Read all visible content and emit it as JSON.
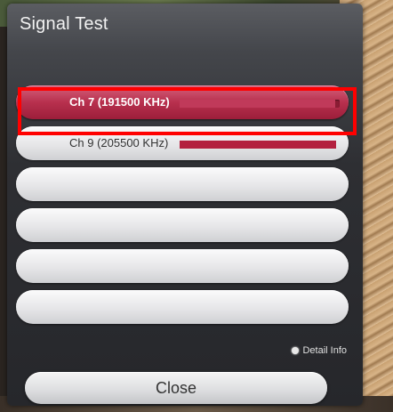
{
  "dialog": {
    "title": "Signal Test",
    "channels": [
      {
        "label": "Ch 7 (191500 KHz)",
        "signal_level": 0.97,
        "selected": true
      },
      {
        "label": "Ch 9 (205500 KHz)",
        "signal_level": 0.98,
        "selected": false
      },
      {
        "label": "",
        "selected": false
      },
      {
        "label": "",
        "selected": false
      },
      {
        "label": "",
        "selected": false
      },
      {
        "label": "",
        "selected": false
      }
    ],
    "detail_info_label": "Detail Info",
    "close_label": "Close"
  },
  "colors": {
    "accent": "#b3203f",
    "highlight_box": "#ff0000"
  }
}
